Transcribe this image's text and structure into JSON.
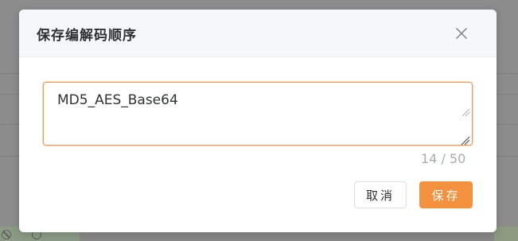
{
  "dialog": {
    "title": "保存编解码顺序",
    "close_icon": "close-icon",
    "textarea": {
      "value": "MD5_AES_Base64",
      "char_count": "14 / 50"
    },
    "buttons": {
      "cancel_label": "取消",
      "save_label": "保存"
    }
  },
  "colors": {
    "accent": "#f3913f",
    "focus_border": "#f39a5a",
    "header_bg": "#f6f7f8",
    "overlay": "#8c8c8c"
  }
}
